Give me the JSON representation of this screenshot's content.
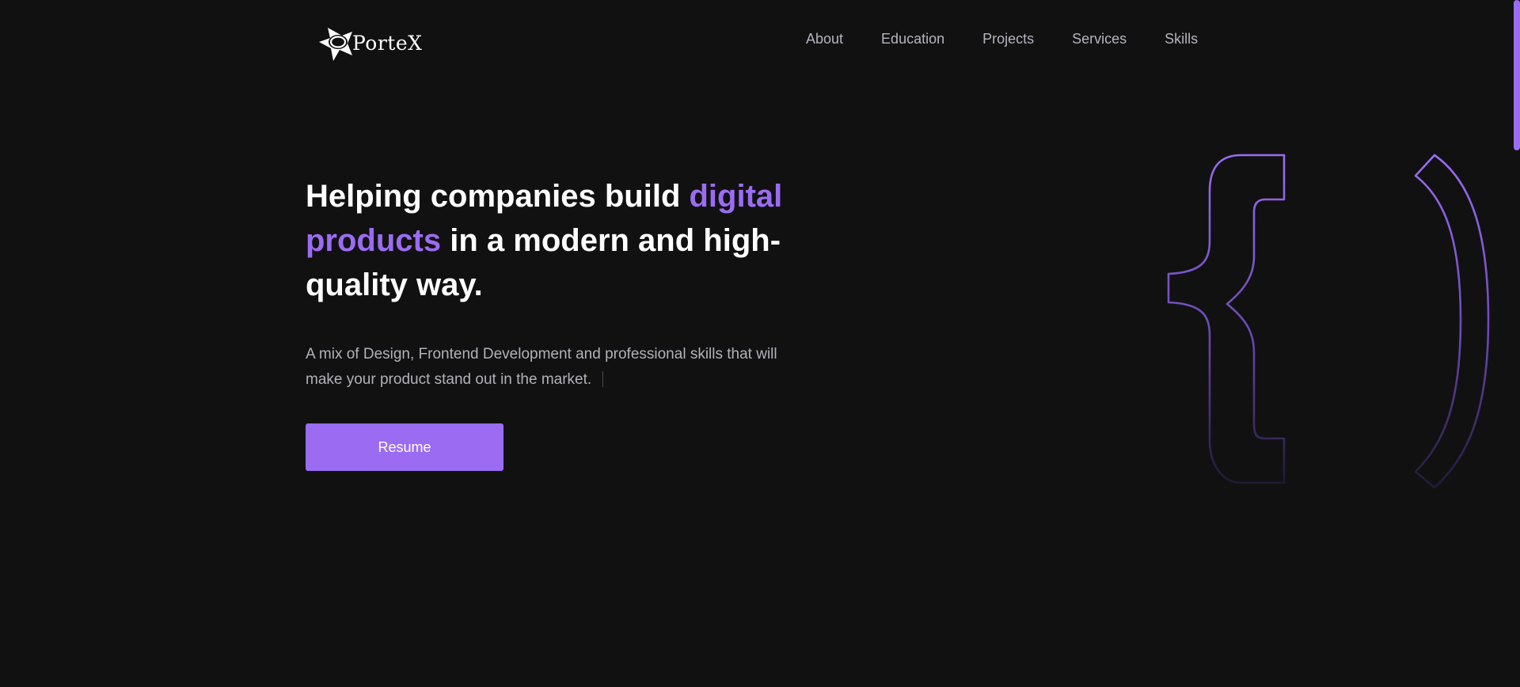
{
  "brand": {
    "logo_icon": "star-planet-icon",
    "name": "PorteX"
  },
  "nav": {
    "items": [
      {
        "label": "About"
      },
      {
        "label": "Education"
      },
      {
        "label": "Projects"
      },
      {
        "label": "Services"
      },
      {
        "label": "Skills"
      }
    ]
  },
  "hero": {
    "title_part1": "Helping companies build ",
    "title_accent": "digital products",
    "title_part2": " in a modern and high-quality way.",
    "subtitle": "A mix of Design, Frontend Development and professional skills that will make your product stand out in the market.",
    "resume_label": "Resume",
    "decoration_icon": "code-braces-icon"
  },
  "colors": {
    "background": "#111112",
    "accent": "#9b6cf2",
    "nav_text": "#b4b4bd",
    "body_text": "#b1b1ba"
  }
}
